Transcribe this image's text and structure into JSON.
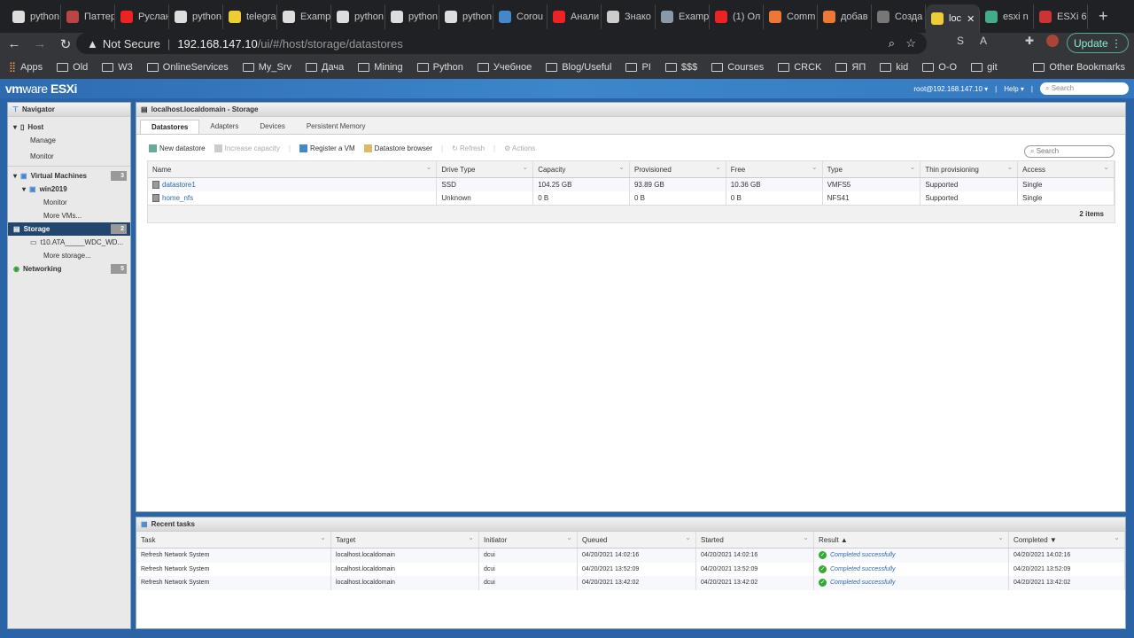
{
  "browser": {
    "tabs": [
      {
        "label": "python",
        "color": "#ddd"
      },
      {
        "label": "Паттерн",
        "color": "#b44"
      },
      {
        "label": "Руслан",
        "color": "#e22"
      },
      {
        "label": "python",
        "color": "#ddd"
      },
      {
        "label": "telegram",
        "color": "#ec3"
      },
      {
        "label": "Example",
        "color": "#ddd"
      },
      {
        "label": "python",
        "color": "#ddd"
      },
      {
        "label": "python",
        "color": "#ddd"
      },
      {
        "label": "python",
        "color": "#ddd"
      },
      {
        "label": "Corou",
        "color": "#48c"
      },
      {
        "label": "Анали",
        "color": "#e22"
      },
      {
        "label": "Знако",
        "color": "#ccc"
      },
      {
        "label": "Examp",
        "color": "#89a"
      },
      {
        "label": "(1) Ол",
        "color": "#e22"
      },
      {
        "label": "Comm",
        "color": "#e73"
      },
      {
        "label": "добав",
        "color": "#e73"
      },
      {
        "label": "Созда",
        "color": "#777"
      },
      {
        "label": "loc",
        "color": "#ec3",
        "active": true
      },
      {
        "label": "esxi n",
        "color": "#4a8"
      },
      {
        "label": "ESXi 6",
        "color": "#c33"
      }
    ],
    "new_tab": "+",
    "not_secure": "Not Secure",
    "url_host": "192.168.147.10",
    "url_path": "/ui/#/host/storage/datastores",
    "update_label": "Update",
    "bookmarks": [
      "Apps",
      "Old",
      "W3",
      "OnlineServices",
      "My_Srv",
      "Дача",
      "Mining",
      "Python",
      "Учебное",
      "Blog/Useful",
      "PI",
      "$$$",
      "Courses",
      "CRCK",
      "ЯП",
      "kid",
      "O-O",
      "git"
    ],
    "other_bookmarks": "Other Bookmarks"
  },
  "esxi": {
    "logo_vm": "vm",
    "logo_ware": "ware",
    "logo_esxi": " ESXi",
    "user": "root@192.168.147.10 ▾",
    "help": "Help ▾",
    "search_placeholder": "Search"
  },
  "navigator": {
    "title": "Navigator",
    "host": "Host",
    "manage": "Manage",
    "monitor": "Monitor",
    "vms": "Virtual Machines",
    "vms_count": "3",
    "win2019": "win2019",
    "vm_monitor": "Monitor",
    "more_vms": "More VMs...",
    "storage": "Storage",
    "storage_count": "2",
    "disk": "t10.ATA_____WDC_WD...",
    "more_storage": "More storage...",
    "networking": "Networking",
    "networking_count": "5"
  },
  "main": {
    "title": "localhost.localdomain - Storage",
    "tabs": [
      "Datastores",
      "Adapters",
      "Devices",
      "Persistent Memory"
    ],
    "toolbar": {
      "new_datastore": "New datastore",
      "increase_capacity": "Increase capacity",
      "register_vm": "Register a VM",
      "datastore_browser": "Datastore browser",
      "refresh": "Refresh",
      "actions": "Actions"
    },
    "search_placeholder": "Search",
    "columns": [
      "Name",
      "Drive Type",
      "Capacity",
      "Provisioned",
      "Free",
      "Type",
      "Thin provisioning",
      "Access"
    ],
    "rows": [
      [
        "datastore1",
        "SSD",
        "104.25 GB",
        "93.89 GB",
        "10.36 GB",
        "VMFS5",
        "Supported",
        "Single"
      ],
      [
        "home_nfs",
        "Unknown",
        "0 B",
        "0 B",
        "0 B",
        "NFS41",
        "Supported",
        "Single"
      ]
    ],
    "item_count": "2 items"
  },
  "tasks": {
    "title": "Recent tasks",
    "columns": [
      "Task",
      "Target",
      "Initiator",
      "Queued",
      "Started",
      "Result ▲",
      "Completed ▼"
    ],
    "rows": [
      [
        "Refresh Network System",
        "localhost.localdomain",
        "dcui",
        "04/20/2021 14:02:16",
        "04/20/2021 14:02:16",
        "Completed successfully",
        "04/20/2021 14:02:16"
      ],
      [
        "Refresh Network System",
        "localhost.localdomain",
        "dcui",
        "04/20/2021 13:52:09",
        "04/20/2021 13:52:09",
        "Completed successfully",
        "04/20/2021 13:52:09"
      ],
      [
        "Refresh Network System",
        "localhost.localdomain",
        "dcui",
        "04/20/2021 13:42:02",
        "04/20/2021 13:42:02",
        "Completed successfully",
        "04/20/2021 13:42:02"
      ]
    ]
  }
}
